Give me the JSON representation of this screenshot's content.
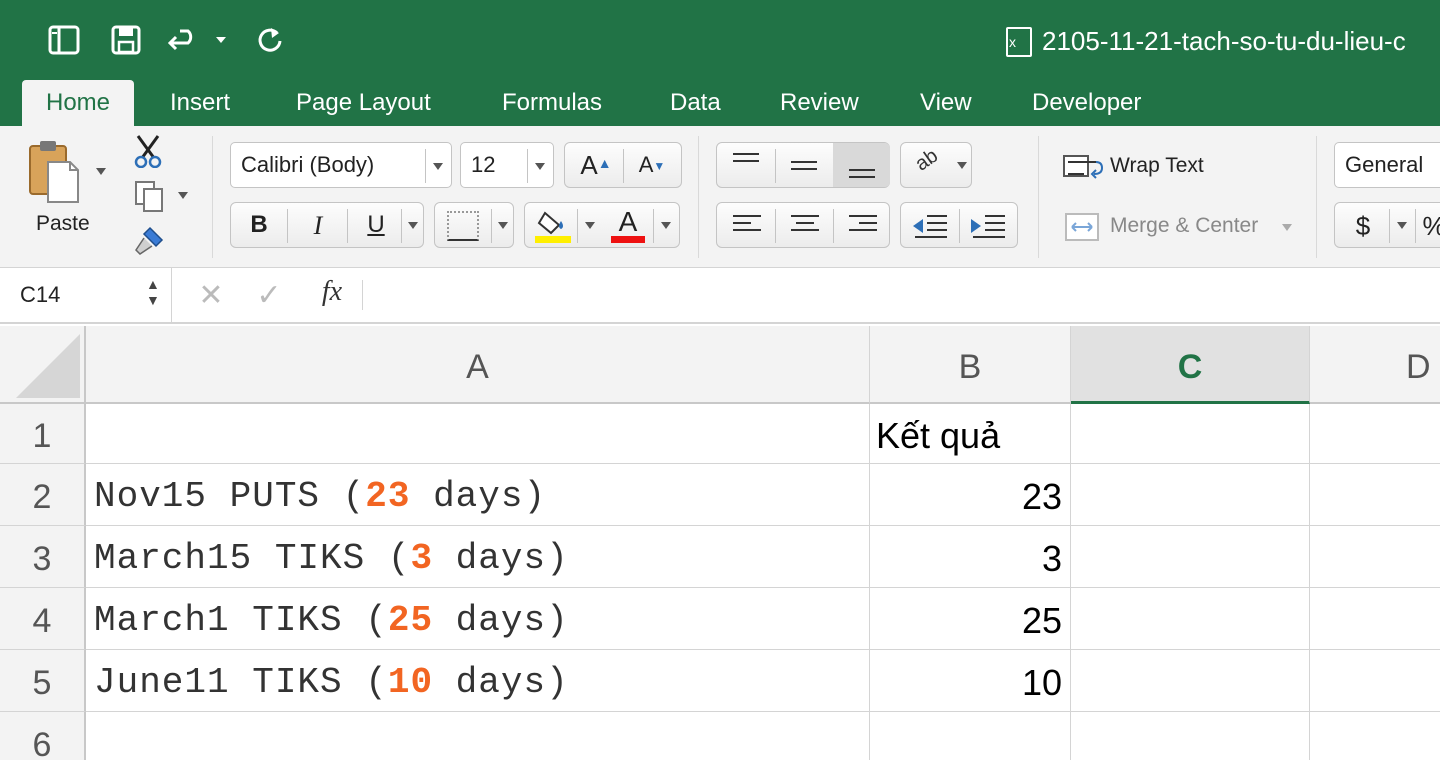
{
  "window": {
    "title": "2105-11-21-tach-so-tu-du-lieu-c",
    "accent": "#217346"
  },
  "tabs": [
    "Home",
    "Insert",
    "Page Layout",
    "Formulas",
    "Data",
    "Review",
    "View",
    "Developer"
  ],
  "active_tab": "Home",
  "ribbon": {
    "paste_label": "Paste",
    "font_name": "Calibri (Body)",
    "font_size": "12",
    "wrap_text_label": "Wrap Text",
    "merge_center_label": "Merge & Center",
    "number_format": "General",
    "currency_symbol": "$",
    "percent_symbol": "%",
    "fill_color": "#ffef00",
    "font_color": "#ee1111"
  },
  "formula_bar": {
    "name_box": "C14",
    "fx_label": "fx",
    "formula": ""
  },
  "columns": [
    "A",
    "B",
    "C",
    "D"
  ],
  "selected_column": "C",
  "rows": [
    "1",
    "2",
    "3",
    "4",
    "5",
    "6"
  ],
  "cells": {
    "B1": "Kết quả",
    "A2": {
      "before": "Nov15 PUTS (",
      "number": "23",
      "after": " days)"
    },
    "B2": "23",
    "A3": {
      "before": "March15 TIKS (",
      "number": "3",
      "after": " days)"
    },
    "B3": "3",
    "A4": {
      "before": "March1 TIKS (",
      "number": "25",
      "after": " days)"
    },
    "B4": "25",
    "A5": {
      "before": "June11 TIKS (",
      "number": "10",
      "after": " days)"
    },
    "B5": "10"
  },
  "highlight_color": "#f26522"
}
